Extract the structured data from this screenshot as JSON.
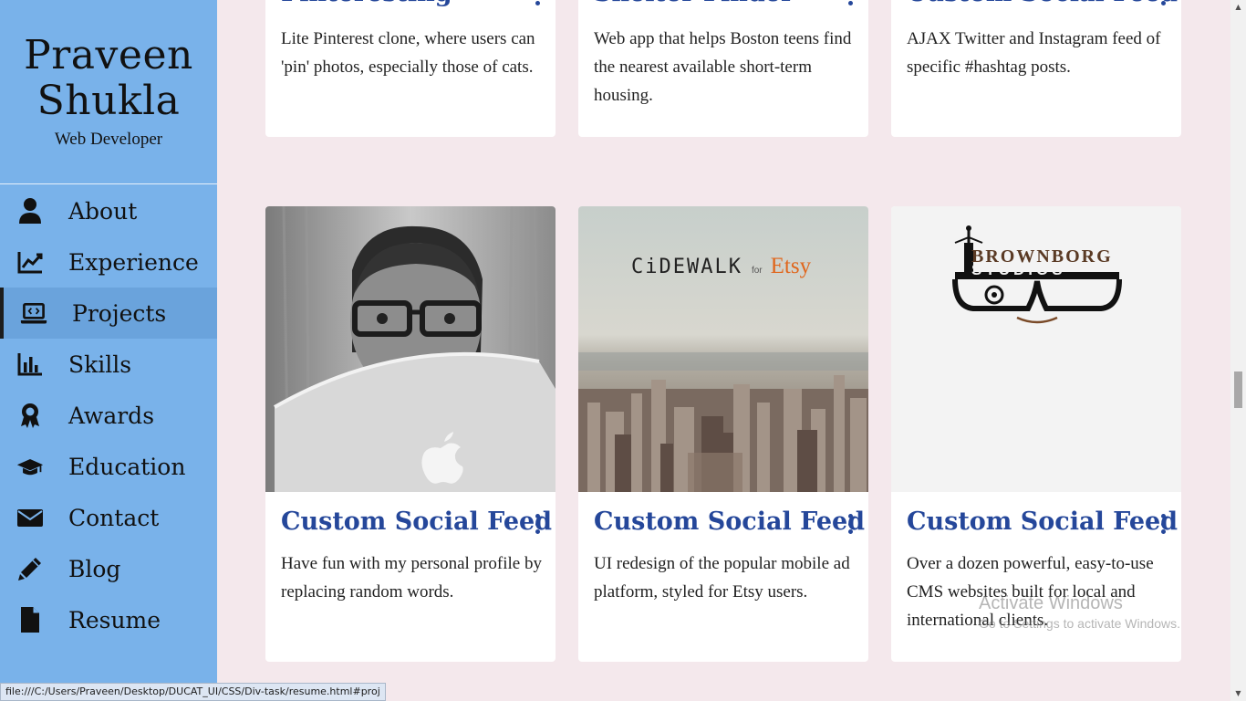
{
  "profile": {
    "name_line1": "Praveen",
    "name_line2": "Shukla",
    "role": "Web Developer"
  },
  "nav": [
    {
      "label": "About",
      "icon": "user-icon"
    },
    {
      "label": "Experience",
      "icon": "chart-line-icon"
    },
    {
      "label": "Projects",
      "icon": "laptop-code-icon",
      "active": true
    },
    {
      "label": "Skills",
      "icon": "bar-chart-icon"
    },
    {
      "label": "Awards",
      "icon": "award-icon"
    },
    {
      "label": "Education",
      "icon": "graduation-cap-icon"
    },
    {
      "label": "Contact",
      "icon": "envelope-icon"
    },
    {
      "label": "Blog",
      "icon": "pencil-icon"
    },
    {
      "label": "Resume",
      "icon": "file-icon"
    }
  ],
  "projects_top": [
    {
      "title": "Pinteresting",
      "description": "Lite Pinterest clone, where users can 'pin' photos, especially those of cats."
    },
    {
      "title": "Shelter Finder",
      "description": "Web app that helps Boston teens find the nearest available short-term housing."
    },
    {
      "title": "Custom Social Feed",
      "description": "AJAX Twitter and Instagram feed of specific #hashtag posts."
    }
  ],
  "projects_bottom": [
    {
      "title": "Custom Social Feed",
      "description": "Have fun with my personal profile by replacing random words.",
      "image": "photo-person-laptop"
    },
    {
      "title": "Custom Social Feed",
      "description": "UI redesign of the popular mobile ad platform, styled for Etsy users.",
      "image": "cidewalk-city-photo"
    },
    {
      "title": "Custom Social Feed",
      "description": "Over a dozen powerful, easy-to-use CMS websites built for local and international clients.",
      "image": "brownborg-studios-logo"
    }
  ],
  "cidewalk_logo": {
    "word": "CiDEWALK",
    "for": "for",
    "brand": "Etsy"
  },
  "brownborg_logo": {
    "line1": "BROWNBORG",
    "line2": "STUDIOS"
  },
  "status_url": "file:///C:/Users/Praveen/Desktop/DUCAT_UI/CSS/Div-task/resume.html#proj",
  "watermark": {
    "line1": "Activate Windows",
    "line2": "Go to Settings to activate Windows."
  },
  "colors": {
    "sidebar": "#79b2ea",
    "sidebar_active": "#6aa3dc",
    "page_bg": "#f4e8ec",
    "title": "#25479a"
  }
}
